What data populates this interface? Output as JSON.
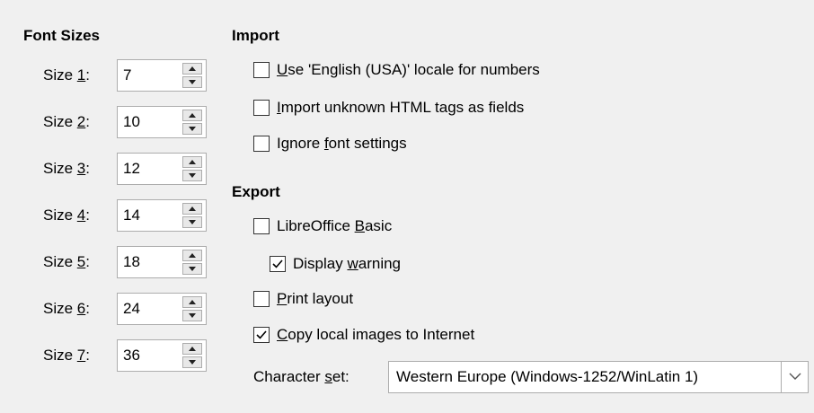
{
  "font_sizes": {
    "heading": "Font Sizes",
    "rows": [
      {
        "pre": "Size ",
        "key": "1",
        "post": ":",
        "value": "7"
      },
      {
        "pre": "Size ",
        "key": "2",
        "post": ":",
        "value": "10"
      },
      {
        "pre": "Size ",
        "key": "3",
        "post": ":",
        "value": "12"
      },
      {
        "pre": "Size ",
        "key": "4",
        "post": ":",
        "value": "14"
      },
      {
        "pre": "Size ",
        "key": "5",
        "post": ":",
        "value": "18"
      },
      {
        "pre": "Size ",
        "key": "6",
        "post": ":",
        "value": "24"
      },
      {
        "pre": "Size ",
        "key": "7",
        "post": ":",
        "value": "36"
      }
    ]
  },
  "import": {
    "heading": "Import",
    "options": [
      {
        "pre": "",
        "key": "U",
        "post": "se 'English (USA)' locale for numbers",
        "checked": false
      },
      {
        "pre": "",
        "key": "I",
        "post": "mport unknown HTML tags as fields",
        "checked": false
      },
      {
        "pre": "Ignore ",
        "key": "f",
        "post": "ont settings",
        "checked": false
      }
    ]
  },
  "export": {
    "heading": "Export",
    "options": [
      {
        "pre": "LibreOffice ",
        "key": "B",
        "post": "asic",
        "checked": false
      },
      {
        "pre": "Display ",
        "key": "w",
        "post": "arning",
        "checked": true
      },
      {
        "pre": "",
        "key": "P",
        "post": "rint layout",
        "checked": false
      },
      {
        "pre": "",
        "key": "C",
        "post": "opy local images to Internet",
        "checked": true
      }
    ],
    "charset": {
      "label_pre": "Character ",
      "label_key": "s",
      "label_post": "et:",
      "value": "Western Europe (Windows-1252/WinLatin 1)"
    }
  },
  "colors": {
    "background": "#f0f0f0",
    "border": "#adadad"
  }
}
